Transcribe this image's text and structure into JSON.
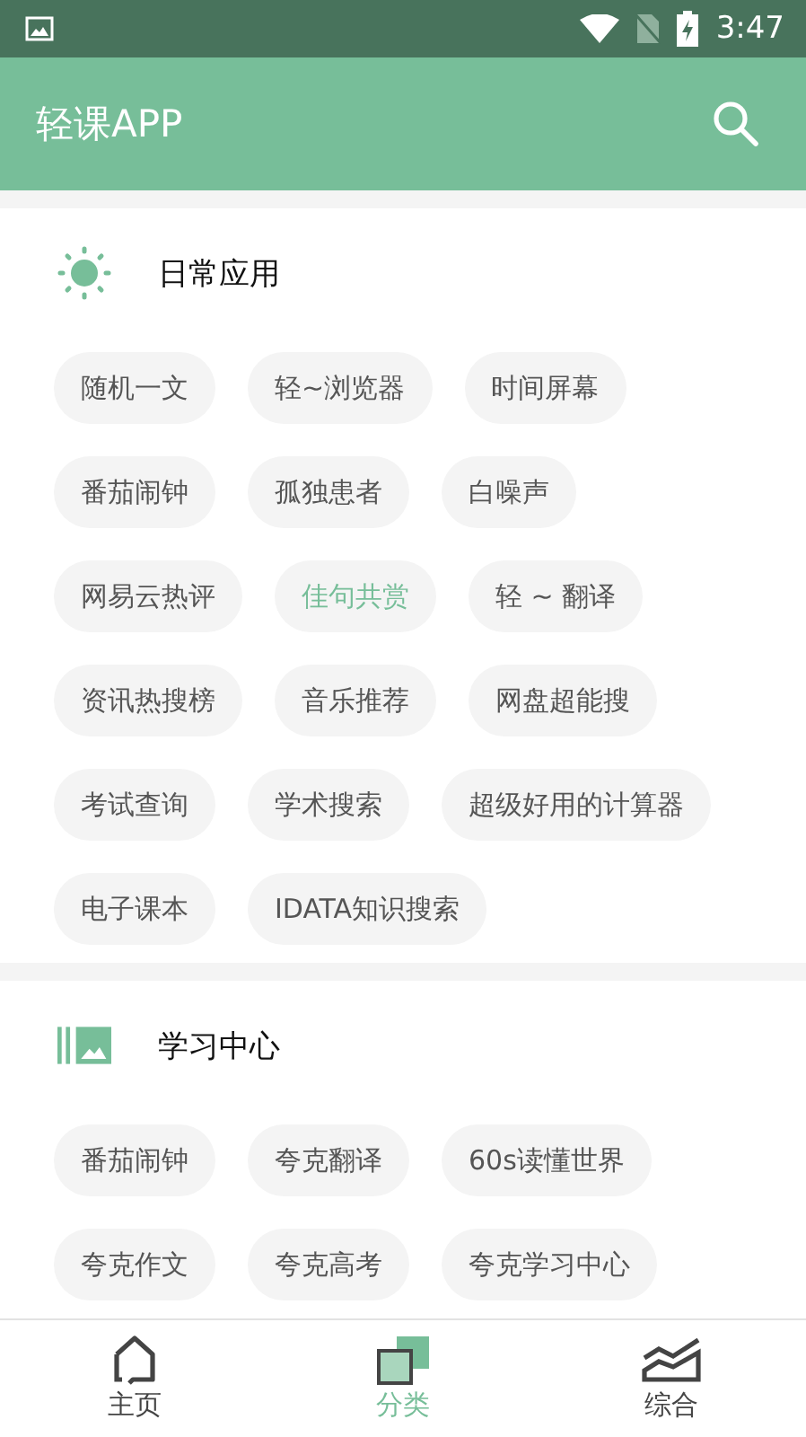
{
  "status_bar": {
    "time": "3:47"
  },
  "app_bar": {
    "title": "轻课APP"
  },
  "sections": [
    {
      "kind": "sun",
      "title": "日常应用",
      "chips": [
        {
          "label": "随机一文",
          "selected": false
        },
        {
          "label": "轻~浏览器",
          "selected": false
        },
        {
          "label": "时间屏幕",
          "selected": false
        },
        {
          "label": "番茄闹钟",
          "selected": false
        },
        {
          "label": "孤独患者",
          "selected": false
        },
        {
          "label": "白噪声",
          "selected": false
        },
        {
          "label": "网易云热评",
          "selected": false
        },
        {
          "label": "佳句共赏",
          "selected": true
        },
        {
          "label": "轻 ~ 翻译",
          "selected": false
        },
        {
          "label": "资讯热搜榜",
          "selected": false
        },
        {
          "label": "音乐推荐",
          "selected": false
        },
        {
          "label": "网盘超能搜",
          "selected": false
        },
        {
          "label": "考试查询",
          "selected": false
        },
        {
          "label": "学术搜索",
          "selected": false
        },
        {
          "label": "超级好用的计算器",
          "selected": false
        },
        {
          "label": "电子课本",
          "selected": false
        },
        {
          "label": "IDATA知识搜索",
          "selected": false
        }
      ]
    },
    {
      "kind": "gallery",
      "title": "学习中心",
      "chips": [
        {
          "label": "番茄闹钟",
          "selected": false
        },
        {
          "label": "夸克翻译",
          "selected": false
        },
        {
          "label": "60s读懂世界",
          "selected": false
        },
        {
          "label": "夸克作文",
          "selected": false
        },
        {
          "label": "夸克高考",
          "selected": false
        },
        {
          "label": "夸克学习中心",
          "selected": false
        }
      ]
    }
  ],
  "bottom_nav": [
    {
      "kind": "home",
      "label": "主页",
      "selected": false
    },
    {
      "kind": "category",
      "label": "分类",
      "selected": true
    },
    {
      "kind": "chart",
      "label": "综合",
      "selected": false
    }
  ]
}
